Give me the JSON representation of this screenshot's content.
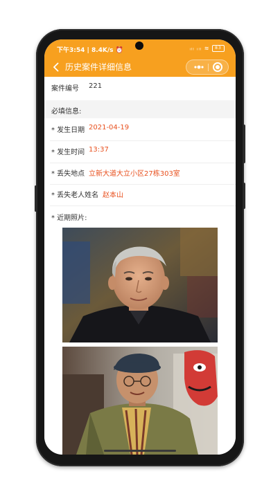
{
  "status_bar": {
    "time": "下午3:54 | 8.4K/s ⏰",
    "icons": "ᵢₗₗ ᵢₗₗ ≋",
    "battery": "83"
  },
  "header": {
    "title": "历史案件详细信息",
    "back_icon": "chevron-left-icon",
    "more_icon": "more-dots-icon",
    "close_icon": "target-circle-icon",
    "color": "#f7a01f"
  },
  "case": {
    "number_label": "案件编号",
    "number_value": "221"
  },
  "required_section": {
    "title": "必填信息:",
    "fields": [
      {
        "label": "* 发生日期",
        "value": "2021-04-19"
      },
      {
        "label": "* 发生时间",
        "value": "13:37"
      },
      {
        "label": "* 丢失地点",
        "value": "立新大道大立小区27栋303室"
      },
      {
        "label": "* 丢失老人姓名",
        "value": "赵本山"
      }
    ],
    "value_color": "#e8501e"
  },
  "photos": {
    "label": "* 近期照片:",
    "items": [
      {
        "description": "portrait-elderly-man-black-jacket"
      },
      {
        "description": "portrait-elderly-man-beret-green-coat"
      }
    ]
  }
}
